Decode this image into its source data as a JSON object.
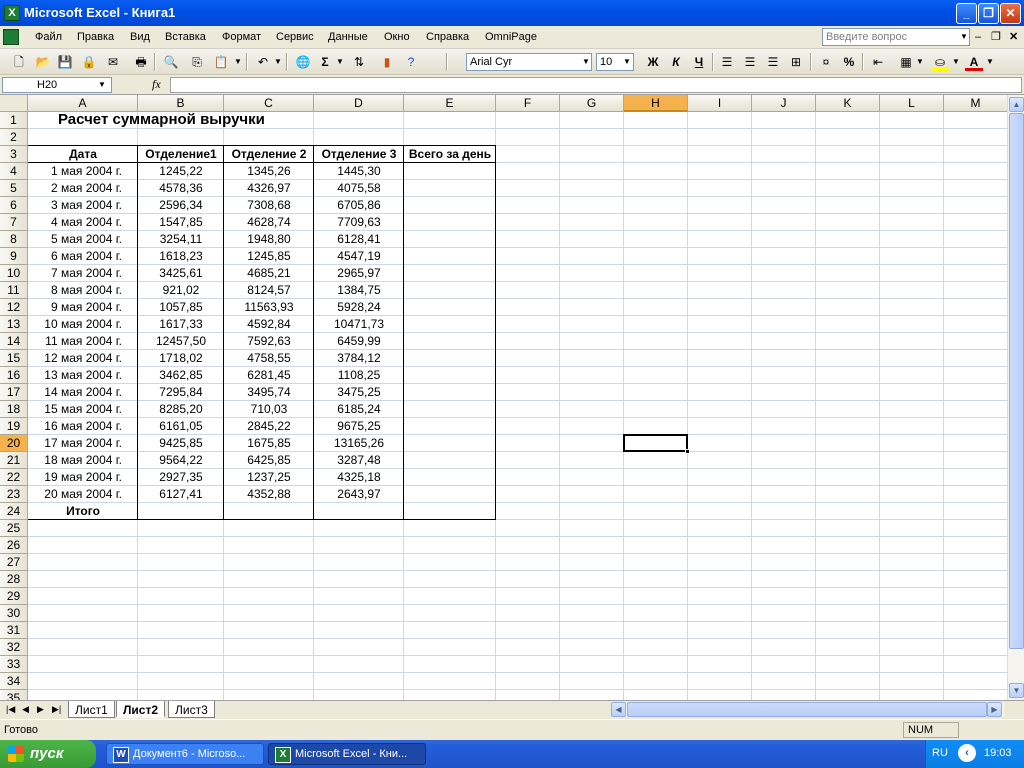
{
  "window": {
    "title": "Microsoft Excel - Книга1",
    "app_icon": "X"
  },
  "menu": {
    "items": [
      "Файл",
      "Правка",
      "Вид",
      "Вставка",
      "Формат",
      "Сервис",
      "Данные",
      "Окно",
      "Справка",
      "OmniPage"
    ],
    "help_placeholder": "Введите вопрос"
  },
  "toolbar": {
    "font": "Arial Cyr",
    "size": "10",
    "bold": "Ж",
    "italic": "К",
    "underline": "Ч",
    "percent": "%",
    "sum": "Σ"
  },
  "formula_bar": {
    "name_box": "H20",
    "fx": "fx",
    "value": ""
  },
  "grid": {
    "columns": [
      "A",
      "B",
      "C",
      "D",
      "E",
      "F",
      "G",
      "H",
      "I",
      "J",
      "K",
      "L",
      "M"
    ],
    "active_column": "H",
    "active_row": "20",
    "rows": [
      "1",
      "2",
      "3",
      "4",
      "5",
      "6",
      "7",
      "8",
      "9",
      "10",
      "11",
      "12",
      "13",
      "14",
      "15",
      "16",
      "17",
      "18",
      "19",
      "20",
      "21",
      "22",
      "23",
      "24",
      "25",
      "26",
      "27",
      "28",
      "29",
      "30",
      "31",
      "32",
      "33",
      "34",
      "35"
    ]
  },
  "sheet": {
    "title": "Расчет суммарной выручки",
    "headers": [
      "Дата",
      "Отделение1",
      "Отделение 2",
      "Отделение 3",
      "Всего за день"
    ],
    "rows": [
      [
        "1 мая 2004 г.",
        "1245,22",
        "1345,26",
        "1445,30"
      ],
      [
        "2 мая 2004 г.",
        "4578,36",
        "4326,97",
        "4075,58"
      ],
      [
        "3 мая 2004 г.",
        "2596,34",
        "7308,68",
        "6705,86"
      ],
      [
        "4 мая 2004 г.",
        "1547,85",
        "4628,74",
        "7709,63"
      ],
      [
        "5 мая 2004 г.",
        "3254,11",
        "1948,80",
        "6128,41"
      ],
      [
        "6 мая 2004 г.",
        "1618,23",
        "1245,85",
        "4547,19"
      ],
      [
        "7 мая 2004 г.",
        "3425,61",
        "4685,21",
        "2965,97"
      ],
      [
        "8 мая 2004 г.",
        "921,02",
        "8124,57",
        "1384,75"
      ],
      [
        "9 мая 2004 г.",
        "1057,85",
        "11563,93",
        "5928,24"
      ],
      [
        "10 мая 2004 г.",
        "1617,33",
        "4592,84",
        "10471,73"
      ],
      [
        "11 мая 2004 г.",
        "12457,50",
        "7592,63",
        "6459,99"
      ],
      [
        "12 мая 2004 г.",
        "1718,02",
        "4758,55",
        "3784,12"
      ],
      [
        "13 мая 2004 г.",
        "3462,85",
        "6281,45",
        "1108,25"
      ],
      [
        "14 мая 2004 г.",
        "7295,84",
        "3495,74",
        "3475,25"
      ],
      [
        "15 мая 2004 г.",
        "8285,20",
        "710,03",
        "6185,24"
      ],
      [
        "16 мая 2004 г.",
        "6161,05",
        "2845,22",
        "9675,25"
      ],
      [
        "17 мая 2004 г.",
        "9425,85",
        "1675,85",
        "13165,26"
      ],
      [
        "18 мая 2004 г.",
        "9564,22",
        "6425,85",
        "3287,48"
      ],
      [
        "19 мая 2004 г.",
        "2927,35",
        "1237,25",
        "4325,18"
      ],
      [
        "20 мая 2004 г.",
        "6127,41",
        "4352,88",
        "2643,97"
      ]
    ],
    "total_label": "Итого"
  },
  "sheet_tabs": {
    "tabs": [
      "Лист1",
      "Лист2",
      "Лист3"
    ],
    "active": "Лист2"
  },
  "status": {
    "ready": "Готово",
    "num": "NUM"
  },
  "taskbar": {
    "start": "пуск",
    "tasks": [
      "Документ6 - Microso...",
      "Microsoft Excel - Кни..."
    ],
    "lang": "RU",
    "clock": "19:03"
  },
  "colors": {
    "titlebar": "#0054e3",
    "active_header": "#f5b14b",
    "gridline": "#d0d7e5",
    "taskbar": "#245edb",
    "start": "#3c9e36"
  }
}
